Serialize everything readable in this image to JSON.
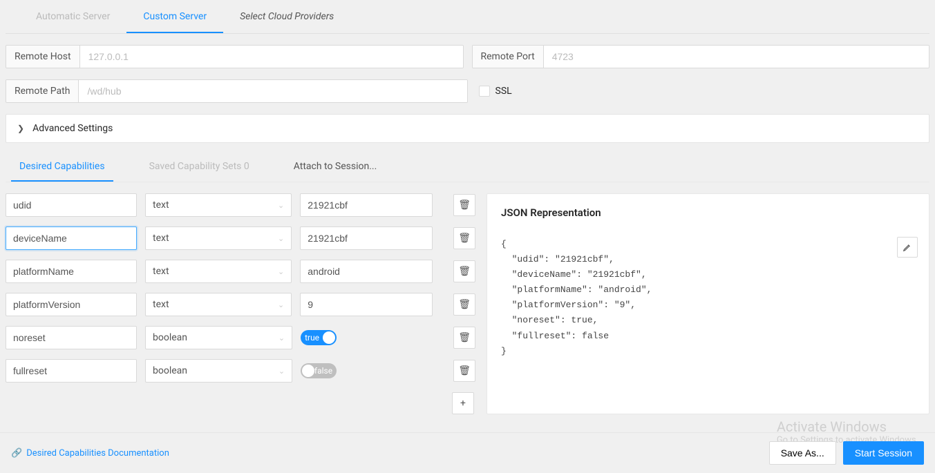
{
  "tabs": {
    "automatic": "Automatic Server",
    "custom": "Custom Server",
    "cloud": "Select Cloud Providers"
  },
  "remoteHost": {
    "label": "Remote Host",
    "placeholder": "127.0.0.1"
  },
  "remotePort": {
    "label": "Remote Port",
    "placeholder": "4723"
  },
  "remotePath": {
    "label": "Remote Path",
    "placeholder": "/wd/hub"
  },
  "ssl": "SSL",
  "advanced": "Advanced Settings",
  "midTabs": {
    "desired": "Desired Capabilities",
    "saved": "Saved Capability Sets 0",
    "attach": "Attach to Session..."
  },
  "caps": [
    {
      "name": "udid",
      "type": "text",
      "value": "21921cbf"
    },
    {
      "name": "deviceName",
      "type": "text",
      "value": "21921cbf"
    },
    {
      "name": "platformName",
      "type": "text",
      "value": "android"
    },
    {
      "name": "platformVersion",
      "type": "text",
      "value": "9"
    },
    {
      "name": "noreset",
      "type": "boolean",
      "value": "true"
    },
    {
      "name": "fullreset",
      "type": "boolean",
      "value": "false"
    }
  ],
  "jsonTitle": "JSON Representation",
  "jsonText": "{\n  \"udid\": \"21921cbf\",\n  \"deviceName\": \"21921cbf\",\n  \"platformName\": \"android\",\n  \"platformVersion\": \"9\",\n  \"noreset\": true,\n  \"fullreset\": false\n}",
  "docLink": "Desired Capabilities Documentation",
  "saveAs": "Save As...",
  "startSession": "Start Session",
  "watermark": {
    "title": "Activate Windows",
    "sub": "Go to Settings to activate Windows."
  }
}
